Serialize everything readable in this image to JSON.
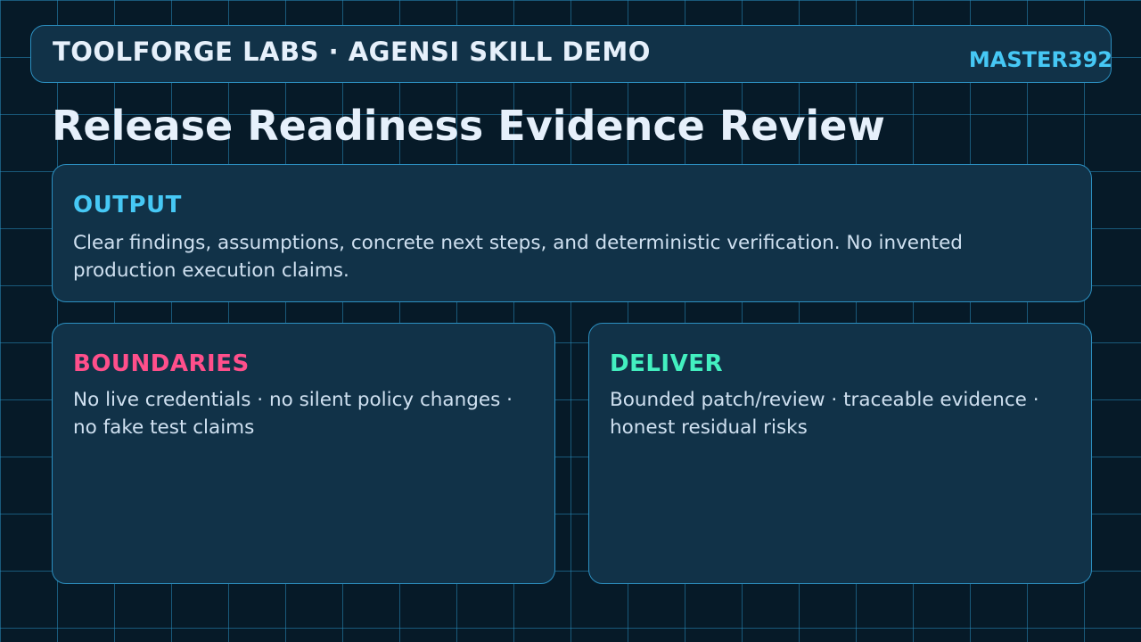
{
  "header": {
    "brand": "TOOLFORGE LABS · AGENSI SKILL DEMO",
    "badge": "MASTER392"
  },
  "page_title": "Release Readiness Evidence Review",
  "cards": [
    {
      "title": "OUTPUT",
      "title_color": "#46c8f5",
      "body": "Clear findings, assumptions, concrete next steps, and deterministic verification. No invented production execution claims."
    },
    {
      "title": "BOUNDARIES",
      "title_color": "#ff4f8b",
      "body": "No live credentials · no silent policy changes · no fake test claims"
    },
    {
      "title": "DELIVER",
      "title_color": "#43f0c0",
      "body": "Bounded patch/review · traceable evidence · honest residual risks"
    }
  ],
  "colors": {
    "background": "#061a28",
    "panel": "#113248",
    "border": "#2c8fc0",
    "text": "#e6f0fb"
  }
}
